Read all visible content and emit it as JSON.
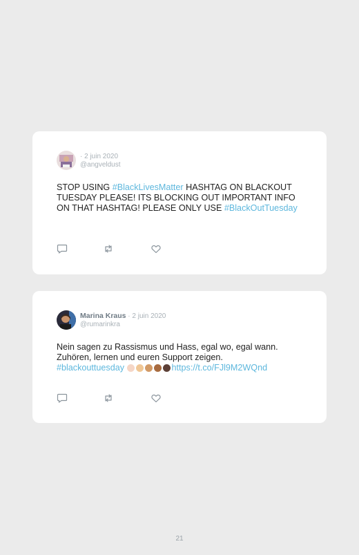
{
  "tweets": [
    {
      "author": "",
      "date": "· 2 juin 2020",
      "handle": "@angveldust",
      "text": [
        {
          "t": "STOP USING "
        },
        {
          "t": "#BlackLivesMatter",
          "link": true
        },
        {
          "t": " HASHTAG ON BLACKOUT TUESDAY PLEASE! ITS BLOCKING OUT IMPORTANT INFO ON THAT HASHTAG! PLEASE ONLY USE "
        },
        {
          "t": "#BlackOutTuesday",
          "link": true
        }
      ]
    },
    {
      "author": "Marina Kraus",
      "date": " · 2 juin 2020",
      "handle": "@rumarinkra",
      "text_plain": "Nein sagen zu Rassismus und Hass, egal wo, egal wann. Zuhören, lernen und euren Support zeigen.",
      "hashtag": "#blackouttuesday",
      "emoji_colors": [
        "#f5d6c6",
        "#f0c796",
        "#d29a66",
        "#a86b3f",
        "#5d4037"
      ],
      "url": "https://t.co/FJl9M2WQnd"
    }
  ],
  "page_number": "21",
  "colors": {
    "link": "#5db7dd",
    "background": "#ebebeb"
  },
  "icons": [
    "reply-icon",
    "retweet-icon",
    "like-icon"
  ]
}
